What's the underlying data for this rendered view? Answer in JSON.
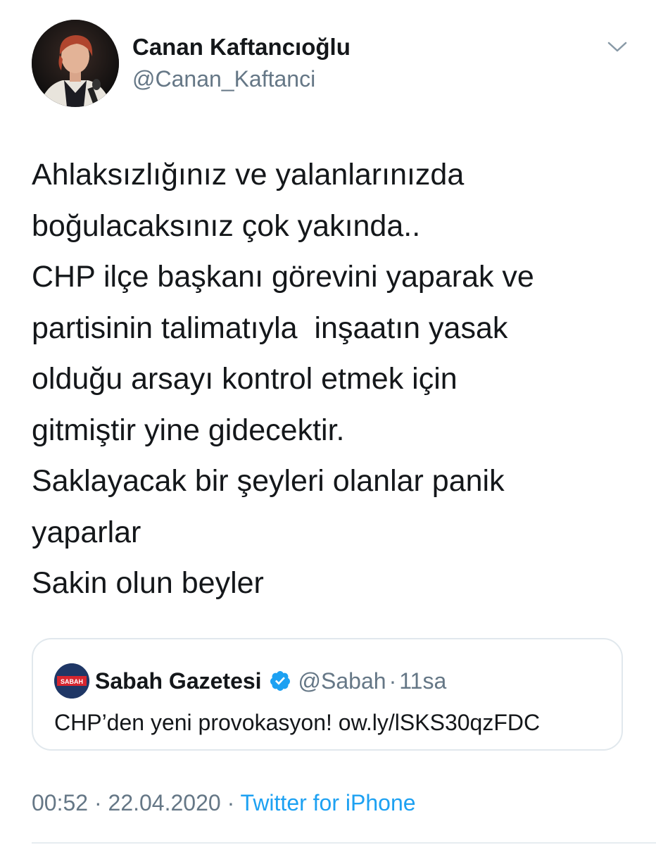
{
  "tweet": {
    "author": {
      "name": "Canan Kaftancıoğlu",
      "handle": "@Canan_Kaftanci"
    },
    "text_lines": [
      "Ahlaksızlığınız ve yalanlarınızda",
      "boğulacaksınız çok yakında..",
      "CHP ilçe başkanı görevini yaparak ve",
      "partisinin talimatıyla  inşaatın yasak",
      "olduğu arsayı kontrol etmek için",
      "gitmiştir yine gidecektir.",
      "Saklayacak bir şeyleri olanlar panik",
      "yaparlar",
      "Sakin olun beyler"
    ],
    "quoted": {
      "avatar_text": "SABAH",
      "name": "Sabah Gazetesi",
      "handle": "@Sabah",
      "separator": "·",
      "time": "11sa",
      "text": "CHP’den yeni provokasyon! ow.ly/lSKS30qzFDC"
    },
    "meta": {
      "time": "00:52",
      "sep1": " · ",
      "date": "22.04.2020",
      "sep2": " · ",
      "source": "Twitter for iPhone"
    },
    "icons": {
      "menu": "chevron-down-icon",
      "verified": "verified-badge-icon"
    },
    "colors": {
      "text": "#14171a",
      "secondary": "#657786",
      "link": "#1da1f2",
      "border": "#e1e8ed"
    }
  }
}
